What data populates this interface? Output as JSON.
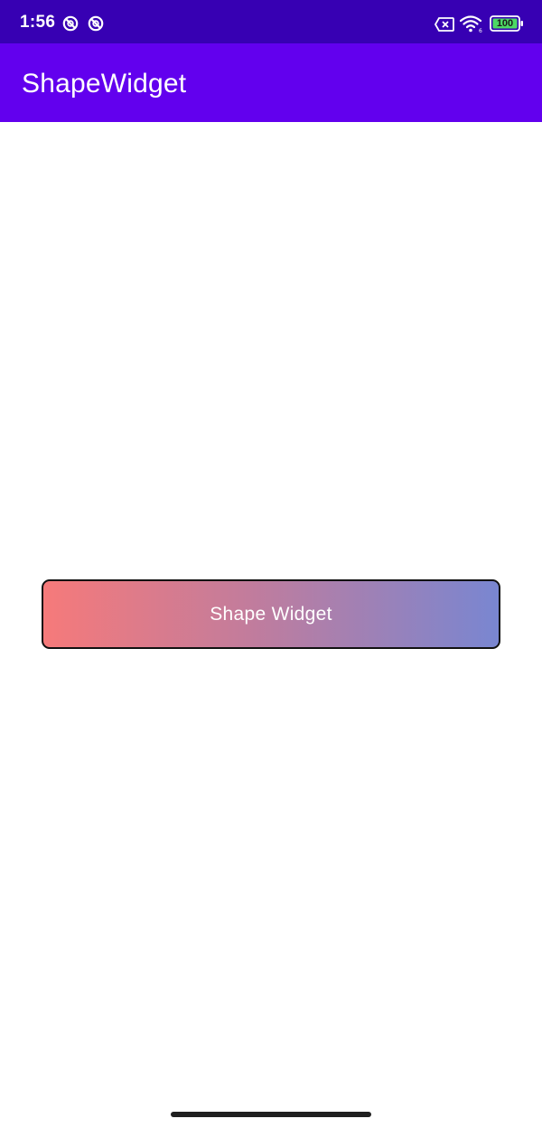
{
  "status_bar": {
    "time": "1:56",
    "left_icons": [
      "no-disturb-icon",
      "no-disturb-icon"
    ],
    "right_icons": [
      "no-sim-icon",
      "wifi-icon",
      "battery-icon"
    ],
    "battery_level": "100",
    "background_color": "#3700B3"
  },
  "app_bar": {
    "title": "ShapeWidget",
    "background_color": "#6200EE"
  },
  "main": {
    "shape_widget": {
      "label": "Shape Widget",
      "gradient_start": "#F67A7A",
      "gradient_end": "#7986D1",
      "border_color": "#111111"
    }
  },
  "colors": {
    "status_bar": "#3700B3",
    "app_bar": "#6200EE",
    "background": "#FFFFFF"
  }
}
